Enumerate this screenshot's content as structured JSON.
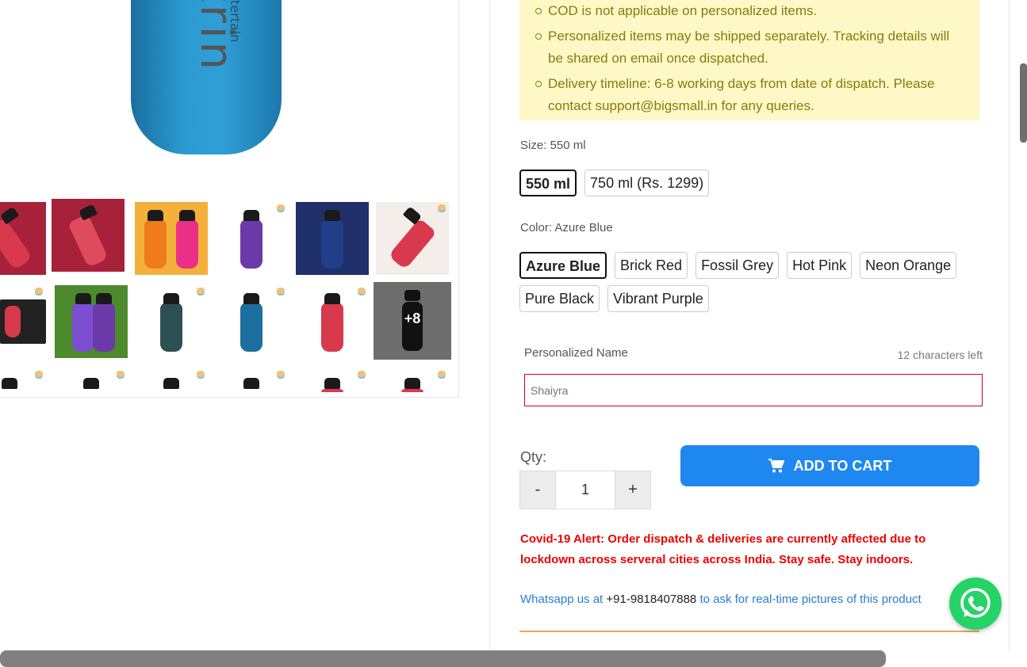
{
  "notice": {
    "items": [
      "COD is not applicable on personalized items.",
      "Personalized items may be shipped separately. Tracking details will be shared on email once dispatched.",
      "Delivery timeline: 6-8 working days from date of dispatch. Please contact support@bigsmall.in for any queries."
    ]
  },
  "gallery": {
    "brand_text": "trin",
    "brand_sub": "entertain",
    "more_label": "+8",
    "colors": {
      "blue": "#2a9ad1",
      "red": "#d9394c",
      "maroon": "#a8213a",
      "orange": "#f07b1c",
      "pink": "#ec2f86",
      "purple": "#6c3aa8",
      "navy": "#1f3f8a",
      "teal": "#2c4f53",
      "black": "#111111",
      "grass": "#4c8a2d"
    }
  },
  "size": {
    "label": "Size: 550 ml",
    "options": [
      "550 ml",
      "750 ml (Rs. 1299)"
    ],
    "selected": "550 ml"
  },
  "color": {
    "label": "Color: Azure Blue",
    "options": [
      "Azure Blue",
      "Brick Red",
      "Fossil Grey",
      "Hot Pink",
      "Neon Orange",
      "Pure Black",
      "Vibrant Purple"
    ],
    "selected": "Azure Blue"
  },
  "personalized": {
    "label": "Personalized Name",
    "chars_left": "12 characters left",
    "placeholder": "Shaiyra"
  },
  "quantity": {
    "label": "Qty:",
    "minus": "-",
    "value": "1",
    "plus": "+"
  },
  "cart": {
    "label": "ADD TO CART",
    "icon": "cart-icon",
    "color": "#1e88f0"
  },
  "covid_alert": "Covid-19 Alert: Order dispatch & deliveries are currently affected due to lockdown across serveral cities across India. Stay safe. Stay indoors.",
  "whatsapp": {
    "prefix": "Whatsapp us at ",
    "number": "+91-9818407888",
    "suffix": " to ask for real-time pictures of this product",
    "icon": "whatsapp-icon",
    "color": "#25d366"
  }
}
